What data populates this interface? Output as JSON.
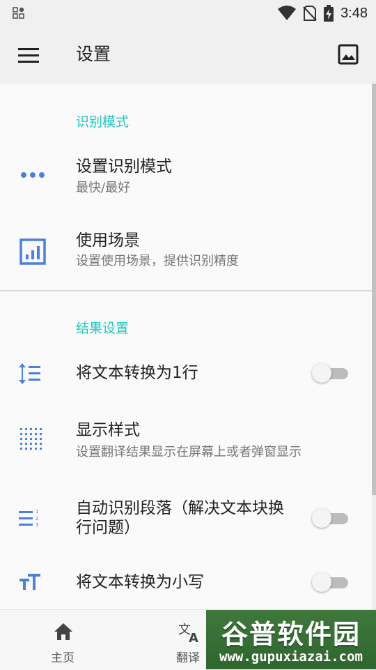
{
  "status_bar": {
    "time": "3:48",
    "icons": [
      "apps-grid-icon",
      "wifi-icon",
      "no-sim-icon",
      "battery-charging-icon"
    ]
  },
  "app_bar": {
    "title": "设置",
    "menu_icon": "hamburger-menu-icon",
    "action_icon": "image-icon"
  },
  "sections": [
    {
      "header": "识别模式",
      "items": [
        {
          "icon": "more-horizontal-icon",
          "title": "设置识别模式",
          "subtitle": "最快/最好"
        },
        {
          "icon": "bar-chart-icon",
          "title": "使用场景",
          "subtitle": "设置使用场景，提供识别精度"
        }
      ]
    },
    {
      "header": "结果设置",
      "items": [
        {
          "icon": "line-spacing-icon",
          "title": "将文本转换为1行",
          "toggle": false
        },
        {
          "icon": "dot-grid-icon",
          "title": "显示样式",
          "subtitle": "设置翻译结果显示在屏幕上或者弹窗显示"
        },
        {
          "icon": "numbered-list-icon",
          "title": "自动识别段落（解决文本块换",
          "title_line2": "行问题）",
          "toggle": false
        },
        {
          "icon": "text-size-icon",
          "title": "将文本转换为小写",
          "toggle": false
        }
      ]
    }
  ],
  "bottom_nav": [
    {
      "icon": "home-icon",
      "label": "主页"
    },
    {
      "icon": "translate-icon",
      "label": "翻译"
    }
  ],
  "watermark": {
    "title": "谷普软件园",
    "url": "www.gupuxiazai.com"
  },
  "colors": {
    "accent": "#20c9c2",
    "icon_blue": "#4a80e0",
    "switch_off_track": "#bcbcbc"
  }
}
